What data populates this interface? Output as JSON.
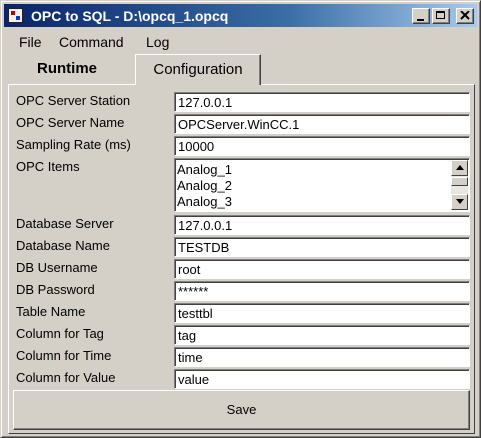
{
  "window": {
    "title": "OPC to SQL - D:\\opcq_1.opcq"
  },
  "menu": {
    "items": [
      "File",
      "Command",
      "Log"
    ]
  },
  "tabs": {
    "runtime": "Runtime",
    "configuration": "Configuration"
  },
  "form": {
    "opc_server_station": {
      "label": "OPC Server Station",
      "value": "127.0.0.1"
    },
    "opc_server_name": {
      "label": "OPC Server Name",
      "value": "OPCServer.WinCC.1"
    },
    "sampling_rate": {
      "label": "Sampling Rate (ms)",
      "value": "10000"
    },
    "opc_items": {
      "label": "OPC Items",
      "items": [
        "Analog_1",
        "Analog_2",
        "Analog_3"
      ]
    },
    "database_server": {
      "label": "Database Server",
      "value": "127.0.0.1"
    },
    "database_name": {
      "label": "Database Name",
      "value": "TESTDB"
    },
    "db_username": {
      "label": "DB Username",
      "value": "root"
    },
    "db_password": {
      "label": "DB Password",
      "value": "******"
    },
    "table_name": {
      "label": "Table Name",
      "value": "testtbl"
    },
    "column_tag": {
      "label": "Column for Tag",
      "value": "tag"
    },
    "column_time": {
      "label": "Column for Time",
      "value": "time"
    },
    "column_value": {
      "label": "Column for Value",
      "value": "value"
    }
  },
  "buttons": {
    "save": "Save"
  },
  "icons": {
    "app": "opc-app-icon",
    "minimize": "minimize-icon",
    "maximize": "maximize-icon",
    "close": "close-icon",
    "scroll_up": "scroll-up-arrow-icon",
    "scroll_down": "scroll-down-arrow-icon"
  },
  "colors": {
    "titlebar_start": "#0a246a",
    "titlebar_end": "#a6caf0",
    "face": "#d4d0c8"
  }
}
